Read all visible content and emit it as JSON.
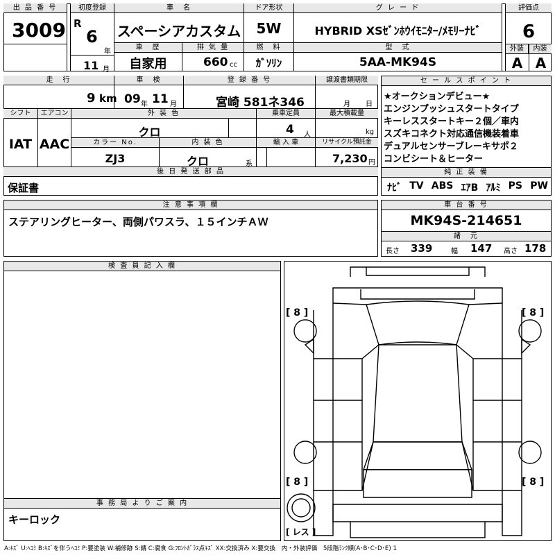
{
  "header": {
    "lot_label": "出 品 番 号",
    "lot_value": "3009",
    "first_reg_label": "初度登録",
    "era_mark": "R",
    "reg_year": "6",
    "year_unit": "年",
    "reg_month": "11",
    "month_unit": "月",
    "car_name_label": "車　名",
    "car_name": "スペーシアカスタム",
    "door_label": "ドア形状",
    "door_value": "5W",
    "grade_label": "グ レ ー ド",
    "grade_value": "HYBRID XSｾﾞﾝﾎｳｲﾓﾆﾀｰ/ﾒﾓﾘｰﾅﾋﾞ",
    "score_label": "評価点",
    "score_value": "6",
    "history_label": "車　歴",
    "history_value": "自家用",
    "displacement_label": "排 気 量",
    "displacement_value": "660",
    "displacement_unit": "cc",
    "fuel_label": "燃　料",
    "fuel_value": "ｶﾞｿﾘﾝ",
    "model_label": "型　式",
    "model_value": "5AA-MK94S",
    "exterior_grade_label": "外装",
    "exterior_grade_value": "A",
    "interior_grade_label": "内装",
    "interior_grade_value": "A"
  },
  "row2": {
    "mileage_label": "走　行",
    "mileage_value": "9",
    "mileage_unit": "km",
    "inspection_label": "車　検",
    "inspection_year": "09",
    "inspection_year_unit": "年",
    "inspection_month": "11",
    "inspection_month_unit": "月",
    "plate_label": "登 録 番 号",
    "plate_value": "宮崎 581ネ346",
    "transfer_label": "譲渡書類期限",
    "transfer_month_unit": "月",
    "transfer_day_unit": "日",
    "shift_label": "シフト",
    "shift_value": "IAT",
    "aircon_label": "エアコン",
    "aircon_value": "AAC",
    "exterior_color_label": "外 装 色",
    "exterior_color_value": "クロ",
    "capacity_label": "乗車定員",
    "capacity_value": "4",
    "capacity_unit": "人",
    "load_label": "最大積載量",
    "load_unit": "kg",
    "color_no_label": "カラー No.",
    "color_no_value": "ZJ3",
    "interior_color_label": "内 装 色",
    "interior_color_value": "クロ",
    "interior_color_unit": "系",
    "import_label": "輸 入 車",
    "recycle_label": "リサイクル預託金",
    "recycle_value": "7,230",
    "recycle_unit": "円",
    "later_parts_label": "後 日 発 送 部 品",
    "later_parts_value": "保証書"
  },
  "sales_points": {
    "label": "セ ー ル ス ポ イ ン ト",
    "lines": [
      "★オークションデビュー★",
      "エンジンプッシュスタートタイプ",
      "キーレススタートキー２個／車内",
      "スズキコネクト対応通信機装着車",
      "デュアルセンサーブレーキサポ２",
      "コンビシート＆ヒーター"
    ]
  },
  "equipment": {
    "label": "純 正 装 備",
    "items": [
      "ﾅﾋﾞ",
      "TV",
      "ABS",
      "ｴｱB",
      "ｱﾙﾐ",
      "PS",
      "PW"
    ]
  },
  "notes": {
    "label": "注 意 事 項 欄",
    "value": "ステアリングヒーター、両側パワスラ、１５インチＡＷ"
  },
  "chassis": {
    "label": "車 台 番 号",
    "value": "MK94S-214651",
    "dims_label": "諸　元",
    "length_label": "長さ",
    "length_value": "339",
    "width_label": "幅",
    "width_value": "147",
    "height_label": "高さ",
    "height_value": "178"
  },
  "inspector": {
    "label": "検 査 員 記 入 欄"
  },
  "office": {
    "label": "事 務 局 よ り ご 案 内",
    "value": "キーロック"
  },
  "diagram": {
    "tire_fl": "[ 8 ]",
    "tire_fr": "[ 8 ]",
    "tire_rl": "[ 8 ]",
    "tire_rr": "[ 8 ]",
    "spare": "[ レス ]"
  },
  "legend": "A:ｷｽﾞ U:ﾍｺﾐ B:ｷｽﾞを伴うﾍｺﾐ P:要塗装 W:補修跡 S:錆 C:腐食 G:ﾌﾛﾝﾄｶﾞﾗｽ点ｷｽﾞ XX:交換済み X:要交換　内・外装評価　5段階ﾗﾝｸ順(A･B･C･D･E) 1"
}
